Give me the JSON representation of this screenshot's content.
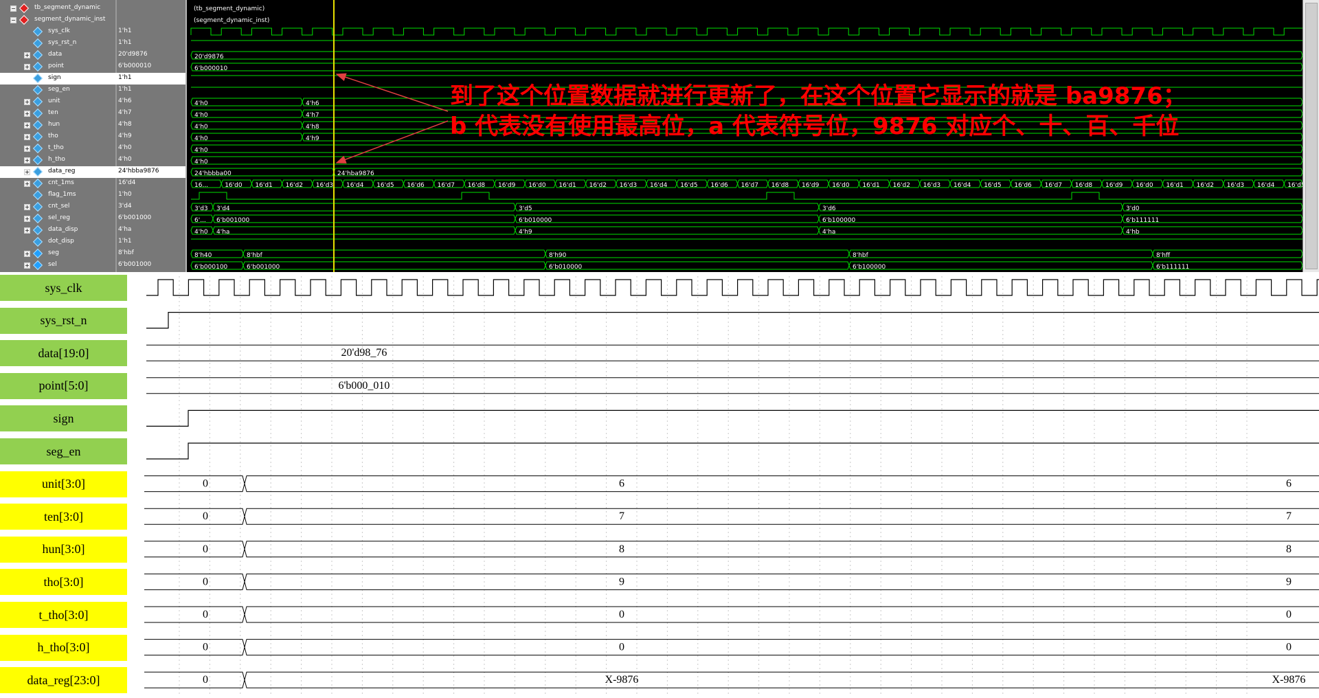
{
  "sim": {
    "signals": [
      {
        "name": "tb_segment_dynamic",
        "value": "",
        "type": "inst",
        "level": 0,
        "expanded": true
      },
      {
        "name": "segment_dynamic_inst",
        "value": "",
        "type": "inst",
        "level": 1,
        "expanded": true
      },
      {
        "name": "sys_clk",
        "value": "1'h1",
        "type": "sig",
        "level": 2
      },
      {
        "name": "sys_rst_n",
        "value": "1'h1",
        "type": "sig",
        "level": 2
      },
      {
        "name": "data",
        "value": "20'd9876",
        "type": "bus",
        "level": 2
      },
      {
        "name": "point",
        "value": "6'b000010",
        "type": "bus",
        "level": 2
      },
      {
        "name": "sign",
        "value": "1'h1",
        "type": "sig",
        "level": 2,
        "selected": true
      },
      {
        "name": "seg_en",
        "value": "1'h1",
        "type": "sig",
        "level": 2
      },
      {
        "name": "unit",
        "value": "4'h6",
        "type": "bus",
        "level": 2
      },
      {
        "name": "ten",
        "value": "4'h7",
        "type": "bus",
        "level": 2
      },
      {
        "name": "hun",
        "value": "4'h8",
        "type": "bus",
        "level": 2
      },
      {
        "name": "tho",
        "value": "4'h9",
        "type": "bus",
        "level": 2
      },
      {
        "name": "t_tho",
        "value": "4'h0",
        "type": "bus",
        "level": 2
      },
      {
        "name": "h_tho",
        "value": "4'h0",
        "type": "bus",
        "level": 2
      },
      {
        "name": "data_reg",
        "value": "24'hbba9876",
        "type": "bus",
        "level": 2,
        "selected": true
      },
      {
        "name": "cnt_1ms",
        "value": "16'd4",
        "type": "bus",
        "level": 2
      },
      {
        "name": "flag_1ms",
        "value": "1'h0",
        "type": "sig",
        "level": 2
      },
      {
        "name": "cnt_sel",
        "value": "3'd4",
        "type": "bus",
        "level": 2
      },
      {
        "name": "sel_reg",
        "value": "6'b001000",
        "type": "bus",
        "level": 2
      },
      {
        "name": "data_disp",
        "value": "4'ha",
        "type": "bus",
        "level": 2
      },
      {
        "name": "dot_disp",
        "value": "1'h1",
        "type": "sig",
        "level": 2
      },
      {
        "name": "seg",
        "value": "8'hbf",
        "type": "bus",
        "level": 2,
        "out": true
      },
      {
        "name": "sel",
        "value": "6'b001000",
        "type": "bus",
        "level": 2,
        "out": true
      }
    ],
    "inst_labels": [
      "(tb_segment_dynamic)",
      "(segment_dynamic_inst)"
    ],
    "wave_labels": {
      "data": "20'd9876",
      "point": "6'b000010",
      "unit": [
        "4'h0",
        "4'h6"
      ],
      "ten": [
        "4'h0",
        "4'h7"
      ],
      "hun": [
        "4'h0",
        "4'h8"
      ],
      "tho": [
        "4'h0",
        "4'h9"
      ],
      "t_tho": "4'h0",
      "h_tho": "4'h0",
      "data_reg": [
        "24'hbbba00",
        "24'hba9876"
      ],
      "cnt_1ms": [
        "16...",
        "16'd0",
        "16'd1",
        "16'd2",
        "16'd3",
        "16'd4",
        "16'd5",
        "16'd6",
        "16'd7",
        "16'd8",
        "16'd9",
        "16'd0",
        "16'd1",
        "16'd2",
        "16'd3",
        "16'd4",
        "16'd5",
        "16'd6",
        "16'd7",
        "16'd8",
        "16'd9",
        "16'd0",
        "16'd1",
        "16'd2",
        "16'd3",
        "16'd4",
        "16'd5",
        "16'd6",
        "16'd7",
        "16'd8",
        "16'd9",
        "16'd0",
        "16'd1",
        "16'd2",
        "16'd3",
        "16'd4",
        "16'd5"
      ],
      "cnt_sel": [
        "3'd3",
        "3'd4",
        "3'd5",
        "3'd6",
        "3'd0"
      ],
      "sel_reg": [
        "6'...",
        "6'b001000",
        "6'b010000",
        "6'b100000",
        "6'b111111"
      ],
      "data_disp": [
        "4'h0",
        "4'ha",
        "4'h9",
        "4'ha",
        "4'hb"
      ],
      "seg": [
        "8'h40",
        "8'hbf",
        "8'h90",
        "8'hbf",
        "8'hff"
      ],
      "sel": [
        "6'b000100",
        "6'b001000",
        "6'b010000",
        "6'b100000",
        "6'b111111"
      ]
    },
    "annotation": [
      "到了这个位置数据就进行更新了，在这个位置它显示的就是 ba9876；",
      "b 代表没有使用最高位，a 代表符号位，9876 对应个、十、百、千位"
    ],
    "colors": {
      "wave": "#00e000",
      "cursor": "#e8e000",
      "annotation": "#ff0000",
      "arrow": "#e04040"
    }
  },
  "diagram": {
    "rows": [
      {
        "label": "sys_clk",
        "type": "clk",
        "color": "#92d050"
      },
      {
        "label": "sys_rst_n",
        "type": "rst",
        "color": "#92d050"
      },
      {
        "label": "data[19:0]",
        "type": "bus",
        "color": "#92d050",
        "values": [
          "20'd98_76"
        ]
      },
      {
        "label": "point[5:0]",
        "type": "bus",
        "color": "#92d050",
        "values": [
          "6'b000_010"
        ]
      },
      {
        "label": "sign",
        "type": "step",
        "color": "#92d050"
      },
      {
        "label": "seg_en",
        "type": "step",
        "color": "#92d050"
      },
      {
        "label": "unit[3:0]",
        "type": "bus2",
        "color": "#ffff00",
        "values": [
          "0",
          "6",
          "6"
        ]
      },
      {
        "label": "ten[3:0]",
        "type": "bus2",
        "color": "#ffff00",
        "values": [
          "0",
          "7",
          "7"
        ]
      },
      {
        "label": "hun[3:0]",
        "type": "bus2",
        "color": "#ffff00",
        "values": [
          "0",
          "8",
          "8"
        ]
      },
      {
        "label": "tho[3:0]",
        "type": "bus2",
        "color": "#ffff00",
        "values": [
          "0",
          "9",
          "9"
        ]
      },
      {
        "label": "t_tho[3:0]",
        "type": "bus2",
        "color": "#ffff00",
        "values": [
          "0",
          "0",
          "0"
        ]
      },
      {
        "label": "h_tho[3:0]",
        "type": "bus2",
        "color": "#ffff00",
        "values": [
          "0",
          "0",
          "0"
        ]
      },
      {
        "label": "data_reg[23:0]",
        "type": "bus2",
        "color": "#ffff00",
        "values": [
          "0",
          "X-9876",
          "X-9876"
        ]
      }
    ]
  }
}
